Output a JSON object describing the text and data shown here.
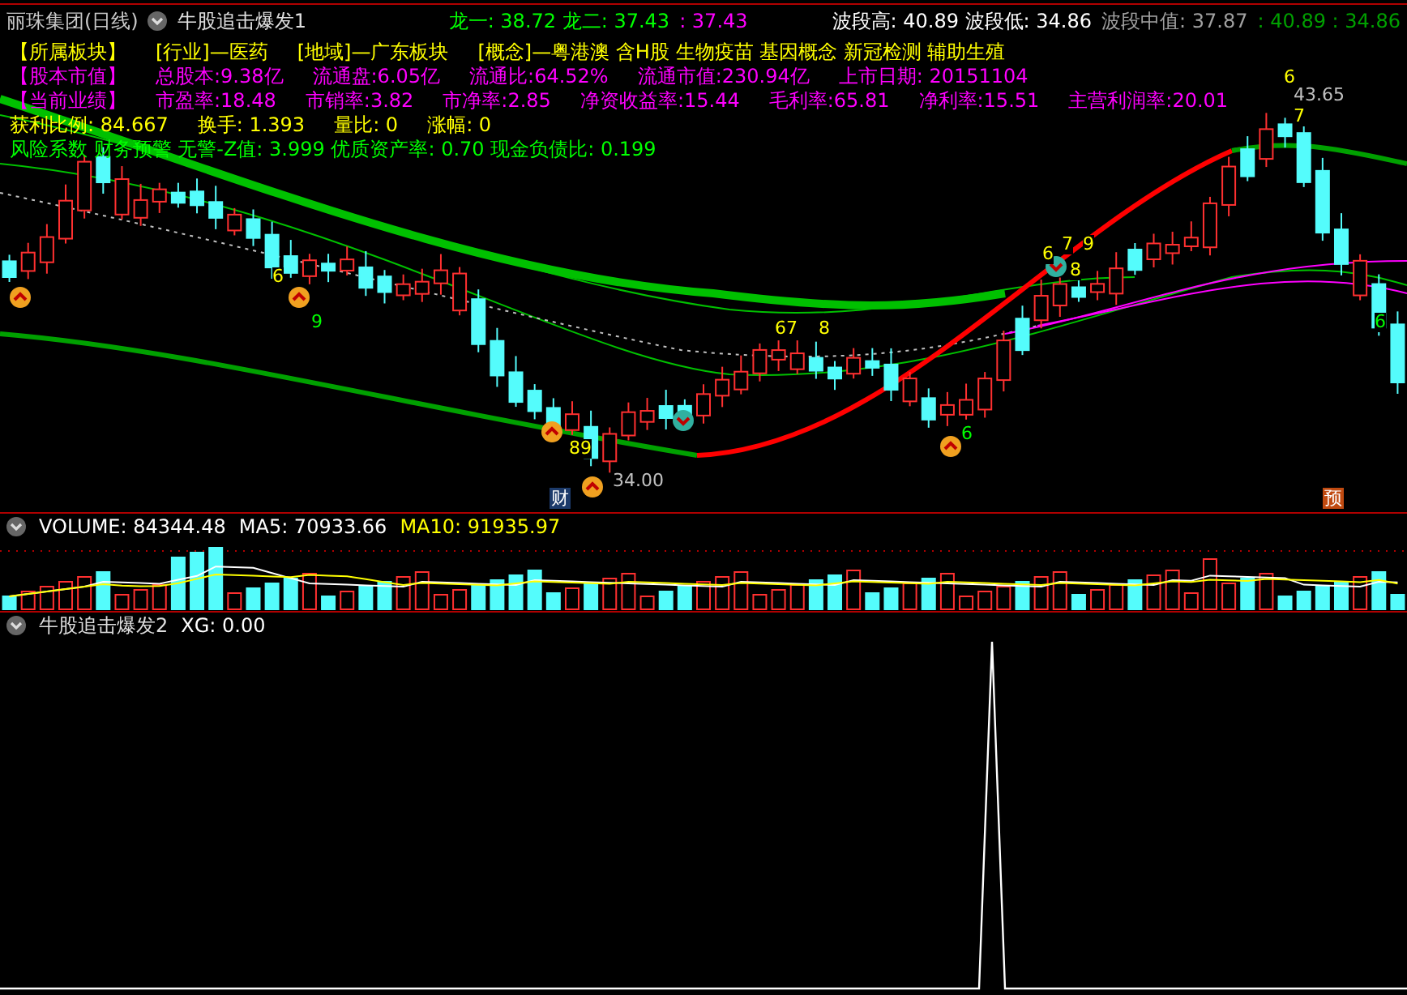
{
  "header": {
    "title": "丽珠集团(日线)",
    "indicator": "牛股追击爆发1",
    "readouts": [
      {
        "text": "龙一: 38.72 龙二: 37.43",
        "color": "#00ff00"
      },
      {
        "text": ": 37.43",
        "color": "#ff00ff"
      },
      {
        "text": "波段高: 40.89 波段低: 34.86",
        "color": "#ffffff"
      },
      {
        "text": "波段中值: 37.87",
        "color": "#a0a0a0"
      },
      {
        "text": ": 40.89 : 34.86",
        "color": "#00a000"
      }
    ]
  },
  "info_lines": [
    {
      "color": "#ffff00",
      "items": [
        "【所属板块】",
        "[行业]—医药",
        "[地域]—广东板块",
        "[概念]—粤港澳 含H股 生物疫苗 基因概念 新冠检测 辅助生殖"
      ]
    },
    {
      "color": "#ff00ff",
      "items": [
        "【股本市值】",
        "总股本:9.38亿",
        "流通盘:6.05亿",
        "流通比:64.52%",
        "流通市值:230.94亿",
        "上市日期: 20151104"
      ]
    },
    {
      "color": "#ff00ff",
      "items": [
        "【当前业绩】",
        "市盈率:18.48",
        "市销率:3.82",
        "市净率:2.85",
        "净资收益率:15.44",
        "毛利率:65.81",
        "净利率:15.51",
        "主营利润率:20.01"
      ]
    },
    {
      "color": "#ffff00",
      "items": [
        "获利比例: 84.667",
        "换手: 1.393",
        "量比: 0",
        "涨幅: 0"
      ]
    },
    {
      "color": "#00ff00",
      "items": [
        "风险系数 财务预警 无警-Z值: 3.999 优质资产率: 0.70 现金负债比: 0.199"
      ]
    }
  ],
  "chart_marks": [
    {
      "text": "6",
      "color": "#ffff00"
    },
    {
      "text": "43.65",
      "color": "#c0c0c0"
    },
    {
      "text": "7",
      "color": "#ffff00"
    },
    {
      "text": "6",
      "color": "#ffff00"
    },
    {
      "text": "7",
      "color": "#ffff00"
    },
    {
      "text": "9",
      "color": "#ffff00"
    },
    {
      "text": "8",
      "color": "#ffff00"
    },
    {
      "text": "6",
      "color": "#ffff00"
    },
    {
      "text": "9",
      "color": "#00ff00"
    },
    {
      "text": "67",
      "color": "#ffff00"
    },
    {
      "text": "8",
      "color": "#ffff00"
    },
    {
      "text": "89",
      "color": "#ffff00"
    },
    {
      "text": "6",
      "color": "#00ff00"
    },
    {
      "text": "6",
      "color": "#00ff00"
    },
    {
      "text": "34.00",
      "color": "#c0c0c0"
    }
  ],
  "event_tags": [
    {
      "text": "财",
      "kind": "finance"
    },
    {
      "text": "预",
      "kind": "forecast"
    }
  ],
  "volume": {
    "readouts": [
      {
        "text": "VOLUME: 84344.48",
        "color": "#ffffff"
      },
      {
        "text": "MA5: 70933.66",
        "color": "#ffffff"
      },
      {
        "text": "MA10: 91935.97",
        "color": "#ffff00"
      }
    ]
  },
  "signal": {
    "title": "牛股追击爆发2",
    "readouts": [
      {
        "text": "XG: 0.00",
        "color": "#ffffff"
      }
    ]
  }
}
